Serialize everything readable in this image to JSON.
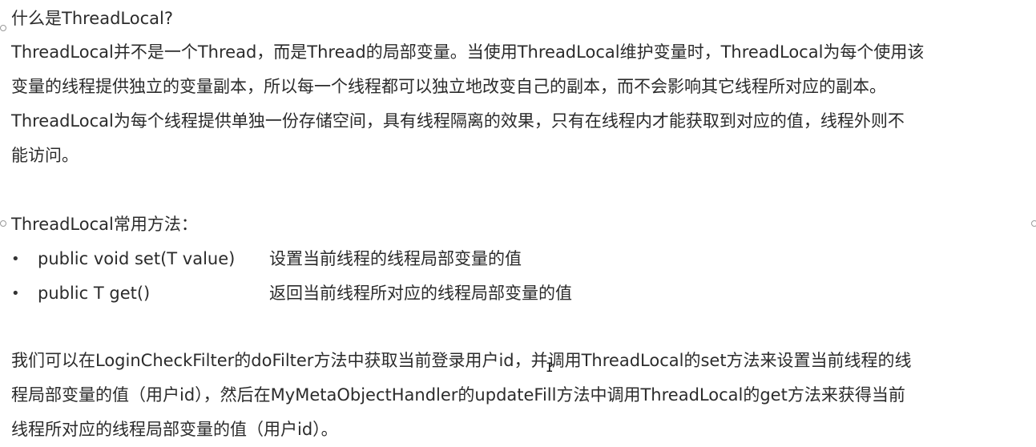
{
  "title": "什么是ThreadLocal?",
  "intro": {
    "line1": "ThreadLocal并不是一个Thread，而是Thread的局部变量。当使用ThreadLocal维护变量时，ThreadLocal为每个使用该",
    "line2": "变量的线程提供独立的变量副本，所以每一个线程都可以独立地改变自己的副本，而不会影响其它线程所对应的副本。",
    "line3": "ThreadLocal为每个线程提供单独一份存储空间，具有线程隔离的效果，只有在线程内才能获取到对应的值，线程外则不",
    "line4": "能访问。"
  },
  "methods": {
    "heading": "ThreadLocal常用方法：",
    "bullet": "•",
    "items": [
      {
        "signature": "public void set(T value)",
        "description": "设置当前线程的线程局部变量的值"
      },
      {
        "signature": "public T get()",
        "description": "返回当前线程所对应的线程局部变量的值"
      }
    ]
  },
  "usage": {
    "line1": "我们可以在LoginCheckFilter的doFilter方法中获取当前登录用户id，并调用ThreadLocal的set方法来设置当前线程的线",
    "line2": "程局部变量的值（用户id），然后在MyMetaObjectHandler的updateFill方法中调用ThreadLocal的get方法来获得当前",
    "line3": "线程所对应的线程局部变量的值（用户id）。"
  },
  "cursor_glyph": "I"
}
